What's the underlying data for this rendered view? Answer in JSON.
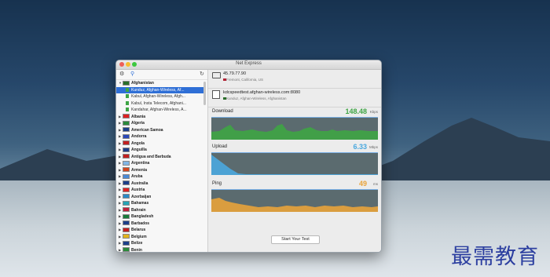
{
  "window": {
    "title": "Net Express"
  },
  "sidebar": {
    "toolbar": {
      "gear_icon": "gear-icon",
      "pin_icon": "pin-icon",
      "refresh_icon": "refresh-icon"
    },
    "tree": [
      {
        "type": "country",
        "label": "Afghanistan",
        "expanded": true,
        "flag": "#2a6e2a"
      },
      {
        "type": "server",
        "label": "Kunduz, Afghan-Wireless, Af...",
        "selected": true
      },
      {
        "type": "server",
        "label": "Kabul, Afghan-Wireless, Afgh..."
      },
      {
        "type": "server",
        "label": "Kabul, Insta Telecom, Afghani..."
      },
      {
        "type": "server",
        "label": "Kandahar, Afghan-Wireless, A..."
      },
      {
        "type": "country",
        "label": "Albania",
        "flag": "#d22"
      },
      {
        "type": "country",
        "label": "Algeria",
        "flag": "#2a8a3a"
      },
      {
        "type": "country",
        "label": "American Samoa",
        "flag": "#1c3f8a"
      },
      {
        "type": "country",
        "label": "Andorra",
        "flag": "#2a48b8"
      },
      {
        "type": "country",
        "label": "Angola",
        "flag": "#c21f1f"
      },
      {
        "type": "country",
        "label": "Anguilla",
        "flag": "#1c3f8a"
      },
      {
        "type": "country",
        "label": "Antigua and Barbuda",
        "flag": "#c21f1f"
      },
      {
        "type": "country",
        "label": "Argentina",
        "flag": "#7fb6e6"
      },
      {
        "type": "country",
        "label": "Armenia",
        "flag": "#d4461f"
      },
      {
        "type": "country",
        "label": "Aruba",
        "flag": "#4a8ad6"
      },
      {
        "type": "country",
        "label": "Australia",
        "flag": "#1c3f8a"
      },
      {
        "type": "country",
        "label": "Austria",
        "flag": "#d22"
      },
      {
        "type": "country",
        "label": "Azerbaijan",
        "flag": "#2a8ac6"
      },
      {
        "type": "country",
        "label": "Bahamas",
        "flag": "#25a4b6"
      },
      {
        "type": "country",
        "label": "Bahrain",
        "flag": "#c21f3a"
      },
      {
        "type": "country",
        "label": "Bangladesh",
        "flag": "#1a7a3a"
      },
      {
        "type": "country",
        "label": "Barbados",
        "flag": "#1c3f8a"
      },
      {
        "type": "country",
        "label": "Belarus",
        "flag": "#c21f1f"
      },
      {
        "type": "country",
        "label": "Belgium",
        "flag": "#e3b41d"
      },
      {
        "type": "country",
        "label": "Belize",
        "flag": "#1c3f8a"
      },
      {
        "type": "country",
        "label": "Benin",
        "flag": "#2a8a3a"
      }
    ]
  },
  "connection": {
    "client": {
      "ip": "45.79.77.90",
      "location": "Fremont, California, US"
    },
    "server": {
      "host": "kdcspeedtest.afghan-wireless.com:8080",
      "location": "Kunduz, Afghan-Wireless, Afghanistan"
    }
  },
  "download": {
    "label": "Download",
    "value": "148.48",
    "unit": "Kbps",
    "color": "#3ea544"
  },
  "upload": {
    "label": "Upload",
    "value": "6.33",
    "unit": "Mbps",
    "color": "#4aa8df"
  },
  "ping": {
    "label": "Ping",
    "value": "49",
    "unit": "ms",
    "color": "#e8a33a"
  },
  "start_button": {
    "label": "Start Your Test"
  },
  "watermark": {
    "text": "最需教育"
  },
  "colors": {
    "accent": "#2f6fd6",
    "download": "#3ea544",
    "upload": "#4aa8df",
    "ping": "#e8a33a"
  }
}
